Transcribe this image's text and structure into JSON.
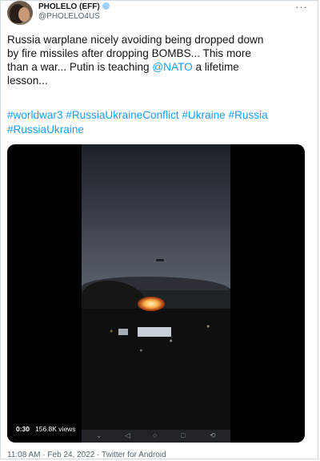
{
  "author": {
    "name": "PHOLELO (EFF)",
    "handle": "@PHOLELO4US"
  },
  "menu": {
    "more": "···"
  },
  "tweet": {
    "text_line1": "Russia warplane nicely avoiding being dropped down",
    "text_line2": "by fire missiles after dropping BOMBS... This more",
    "text_line3": "than a war... Putin is teaching ",
    "mention": "@NATO",
    "text_line3_end": " a lifetime",
    "text_line4": "lesson...",
    "hashtags_line1": "#worldwar3 #RussiaUkraineConflict #Ukraine #Russia",
    "hashtags_line2": "#RussiaUkraine"
  },
  "video": {
    "duration": "0:30",
    "views": "156.8K views",
    "nav_icons": [
      "chevron-down-icon",
      "back-icon",
      "home-icon",
      "recents-icon",
      "rotate-icon"
    ]
  },
  "meta": {
    "time": "11:08 AM",
    "date": "Feb 24, 2022",
    "source": "Twitter for Android",
    "line": "11:08 AM · Feb 24, 2022 · Twitter for Android"
  },
  "colors": {
    "link": "#1d9bf0",
    "text": "#0f1419",
    "secondary": "#536471"
  }
}
